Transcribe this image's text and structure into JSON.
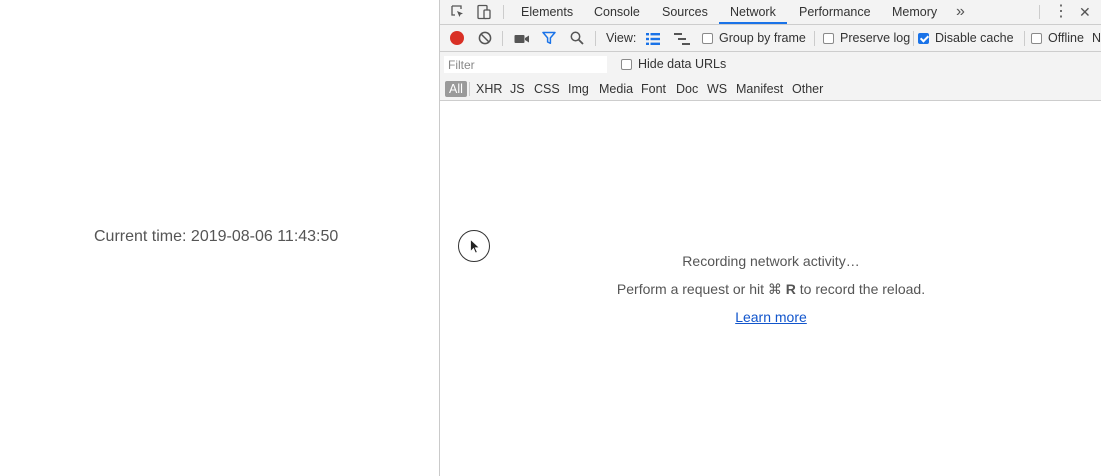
{
  "page": {
    "current_time_label": "Current time: 2019-08-06 11:43:50"
  },
  "devtools": {
    "tabs": [
      {
        "label": "Elements"
      },
      {
        "label": "Console"
      },
      {
        "label": "Sources"
      },
      {
        "label": "Network",
        "active": true
      },
      {
        "label": "Performance"
      },
      {
        "label": "Memory"
      }
    ],
    "more_tabs_glyph": "»",
    "close_glyph": "✕",
    "kebab_glyph": "⋮",
    "toolbar": {
      "view_label": "View:",
      "group_by_frame": {
        "label": "Group by frame",
        "checked": false
      },
      "preserve_log": {
        "label": "Preserve log",
        "checked": false
      },
      "disable_cache": {
        "label": "Disable cache",
        "checked": true
      },
      "offline": {
        "label": "Offline",
        "checked": false
      },
      "overflow_label": "N"
    },
    "filter": {
      "placeholder": "Filter",
      "hide_data_urls": {
        "label": "Hide data URLs",
        "checked": false
      }
    },
    "types": [
      "All",
      "XHR",
      "JS",
      "CSS",
      "Img",
      "Media",
      "Font",
      "Doc",
      "WS",
      "Manifest",
      "Other"
    ],
    "empty_state": {
      "recording": "Recording network activity…",
      "hint_prefix": "Perform a request or hit ⌘",
      "hint_key": "R",
      "hint_suffix": "to record the reload.",
      "learn_more": "Learn more"
    },
    "colors": {
      "record": "#d93025",
      "accent": "#1a73e8",
      "link": "#1155cc"
    }
  }
}
